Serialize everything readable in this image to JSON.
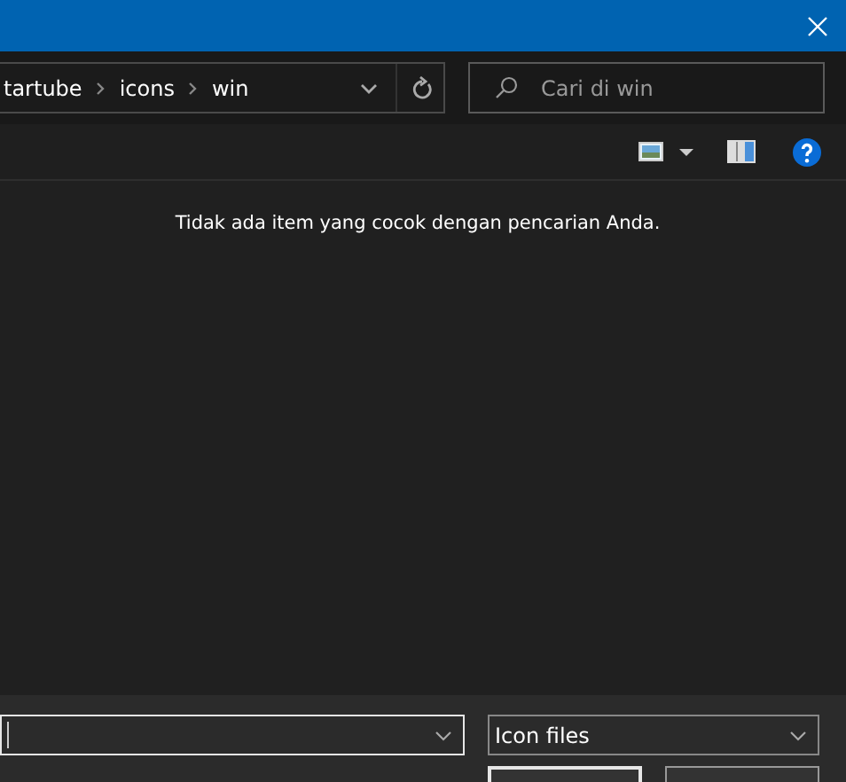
{
  "breadcrumb": [
    {
      "label": "tartube"
    },
    {
      "label": "icons"
    },
    {
      "label": "win"
    }
  ],
  "search": {
    "placeholder": "Cari di win"
  },
  "message": "Tidak ada item yang cocok dengan pencarian Anda.",
  "file_type": {
    "value": "Icon files"
  }
}
